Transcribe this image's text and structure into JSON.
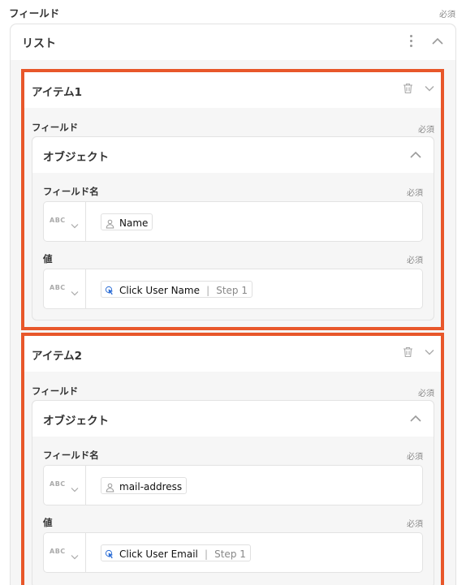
{
  "header": {
    "field_label": "フィールド",
    "required": "必須"
  },
  "list": {
    "title": "リスト"
  },
  "items": [
    {
      "title": "アイテム1",
      "field_label": "フィールド",
      "required": "必須",
      "object": {
        "title": "オブジェクト",
        "name_label": "フィールド名",
        "name_required": "必須",
        "name_type": "ABC",
        "name_value": "Name",
        "value_label": "値",
        "value_required": "必須",
        "value_type": "ABC",
        "value_text": "Click User Name",
        "value_sep": "|",
        "value_step": "Step 1"
      }
    },
    {
      "title": "アイテム2",
      "field_label": "フィールド",
      "required": "必須",
      "object": {
        "title": "オブジェクト",
        "name_label": "フィールド名",
        "name_required": "必須",
        "name_type": "ABC",
        "name_value": "mail-address",
        "value_label": "値",
        "value_required": "必須",
        "value_type": "ABC",
        "value_text": "Click User Email",
        "value_sep": "|",
        "value_step": "Step 1"
      }
    }
  ],
  "colors": {
    "highlight": "#e8572a",
    "click_icon": "#2f6fd6"
  }
}
